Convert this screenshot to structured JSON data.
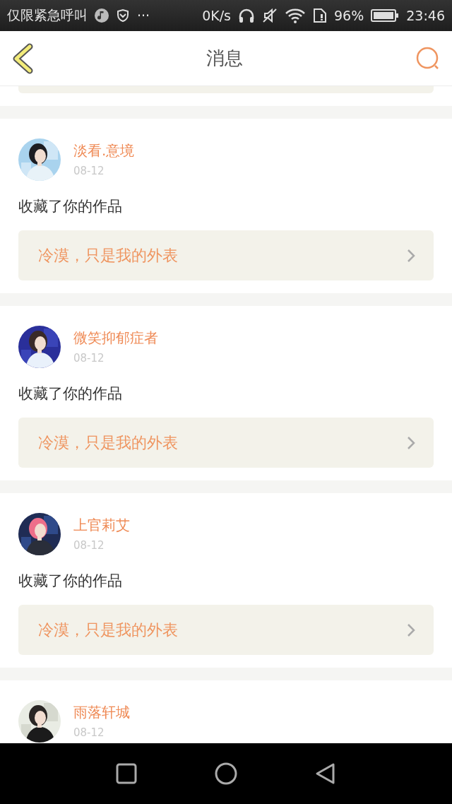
{
  "status_bar": {
    "carrier": "仅限紧急呼叫",
    "more": "···",
    "speed": "0K/s",
    "battery": "96%",
    "time": "23:46"
  },
  "header": {
    "title": "消息"
  },
  "notifications": [
    {
      "user": "淡看.意境",
      "date": "08-12",
      "action": "收藏了你的作品",
      "work_title": "冷漠，只是我的外表"
    },
    {
      "user": "微笑抑郁症者",
      "date": "08-12",
      "action": "收藏了你的作品",
      "work_title": "冷漠，只是我的外表"
    },
    {
      "user": "上官莉艾",
      "date": "08-12",
      "action": "收藏了你的作品",
      "work_title": "冷漠，只是我的外表"
    },
    {
      "user": "雨落轩城",
      "date": "08-12"
    }
  ]
}
